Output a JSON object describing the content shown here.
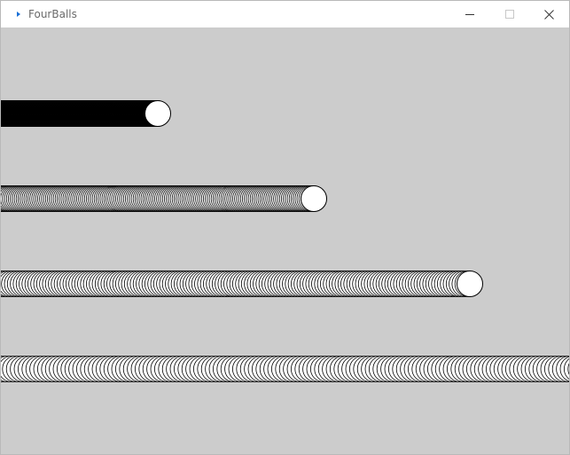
{
  "window": {
    "title": "FourBalls",
    "icons": {
      "app": "processing-sketch-icon",
      "minimize": "minimize-icon",
      "maximize": "maximize-icon",
      "close": "close-icon"
    }
  },
  "sketch": {
    "background_color": "#cccccc",
    "ball_fill": "#ffffff",
    "ball_stroke": "#000000",
    "balls": [
      {
        "name": "ball-1",
        "trail_style": "dense"
      },
      {
        "name": "ball-2",
        "trail_style": "fine-rings"
      },
      {
        "name": "ball-3",
        "trail_style": "rings"
      },
      {
        "name": "ball-4",
        "trail_style": "wide-rings"
      }
    ]
  }
}
